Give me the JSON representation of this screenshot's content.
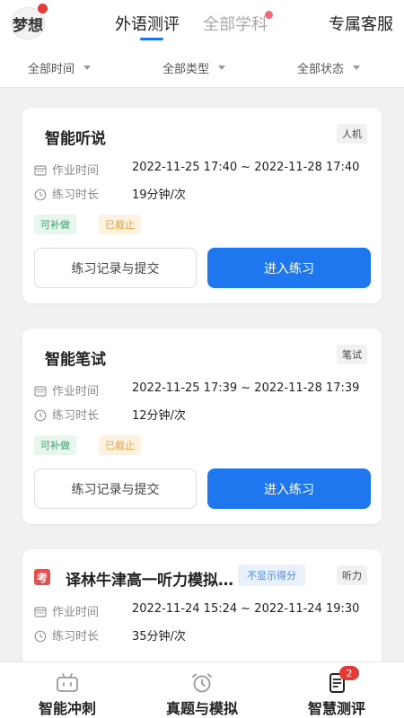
{
  "header": {
    "logo_text": "梦想",
    "tabs": [
      {
        "label": "外语测评",
        "active": true
      },
      {
        "label": "全部学科",
        "active": false
      }
    ],
    "service": "专属客服"
  },
  "filters": [
    {
      "label": "全部时间"
    },
    {
      "label": "全部类型"
    },
    {
      "label": "全部状态"
    }
  ],
  "labels": {
    "work_time": "作业时间",
    "practice_duration": "练习时长",
    "record_button": "练习记录与提交",
    "enter_button": "进入练习"
  },
  "cards": [
    {
      "title": "智能听说",
      "type": "人机",
      "work_time": "2022-11-25 17:40 ~ 2022-11-28 17:40",
      "duration": "19分钟/次",
      "badge_makeup": "可补做",
      "badge_closed": "已截止"
    },
    {
      "title": "智能笔试",
      "type": "笔试",
      "work_time": "2022-11-25 17:39 ~ 2022-11-28 17:39",
      "duration": "12分钟/次",
      "badge_makeup": "可补做",
      "badge_closed": "已截止"
    },
    {
      "kao_icon": "考",
      "title": "译林牛津高一听力模拟测试",
      "score_badge": "不显示得分",
      "type": "听力",
      "work_time": "2022-11-24 15:24 ~ 2022-11-24 19:30",
      "duration": "35分钟/次"
    }
  ],
  "bottom_nav": [
    {
      "label": "智能冲刺",
      "icon": "robot-icon"
    },
    {
      "label": "真题与模拟",
      "icon": "alarm-clock-icon"
    },
    {
      "label": "智慧测评",
      "icon": "document-icon",
      "badge": "2",
      "active": true
    }
  ],
  "colors": {
    "accent": "#1f77f0",
    "green": "#32a66a",
    "orange": "#e9a23b",
    "red": "#e53935"
  }
}
